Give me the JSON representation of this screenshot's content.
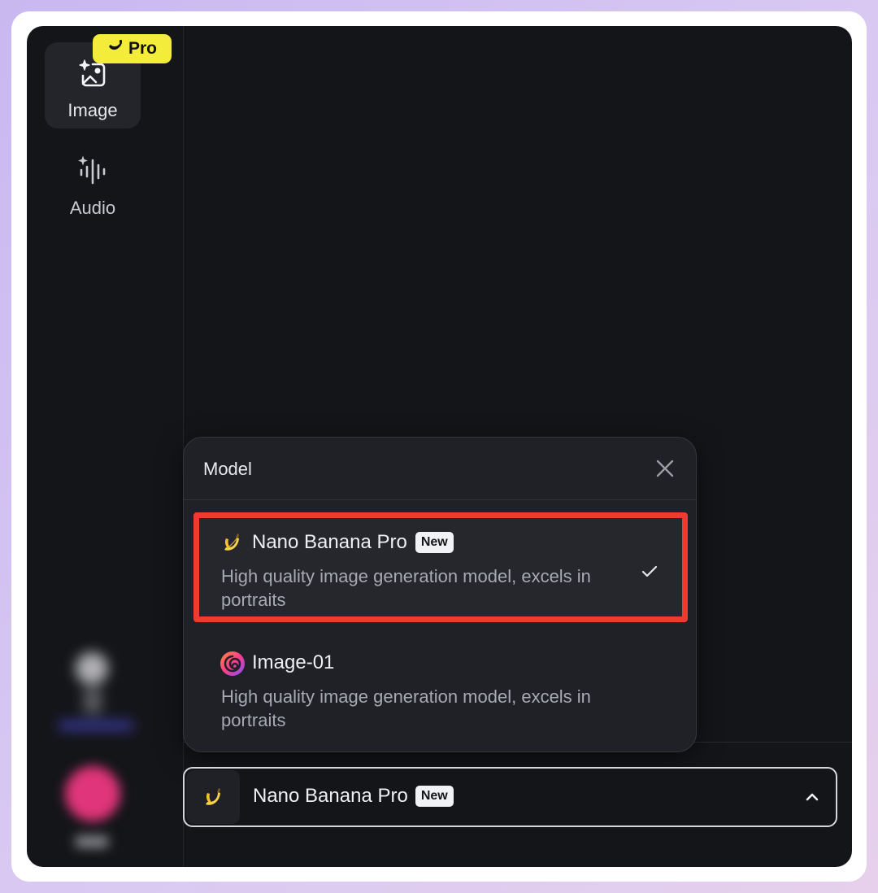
{
  "sidebar": {
    "items": [
      {
        "label": "Image",
        "icon": "image-sparkle-icon",
        "active": true
      },
      {
        "label": "Audio",
        "icon": "audio-waveform-icon",
        "active": false
      }
    ],
    "pro_badge": "Pro"
  },
  "model_popup": {
    "title": "Model",
    "options": [
      {
        "name": "Nano Banana Pro",
        "badge": "New",
        "description": "High quality image generation model, excels in portraits",
        "icon": "banana-icon",
        "selected": true
      },
      {
        "name": "Image-01",
        "description": "High quality image generation model, excels in portraits",
        "icon": "swirl-logo-icon",
        "selected": false
      }
    ]
  },
  "model_selector": {
    "value": "Nano Banana Pro",
    "badge": "New"
  },
  "colors": {
    "highlight_border": "#ee3a32",
    "pro_badge_bg": "#f4ec3b",
    "app_bg": "#141519"
  }
}
